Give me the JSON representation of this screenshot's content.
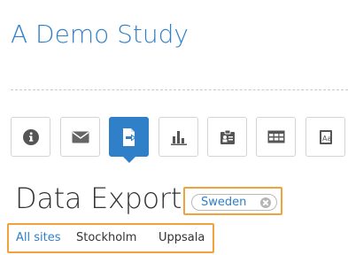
{
  "study": {
    "title": "A Demo Study"
  },
  "toolbar": {
    "buttons": [
      {
        "icon": "info-icon",
        "label": ""
      },
      {
        "icon": "mail-icon",
        "label": ""
      },
      {
        "icon": "export-icon",
        "label": "",
        "active": true
      },
      {
        "icon": "bar-chart-icon",
        "label": ""
      },
      {
        "icon": "id-card-icon",
        "label": ""
      },
      {
        "icon": "table-icon",
        "label": ""
      },
      {
        "icon": "font-icon",
        "label": ""
      }
    ]
  },
  "page": {
    "heading": "Data Export"
  },
  "site_chip": {
    "label": "Sweden"
  },
  "site_links": [
    {
      "label": "All sites",
      "current": true
    },
    {
      "label": "Stockholm",
      "current": false
    },
    {
      "label": "Uppsala",
      "current": false
    }
  ],
  "colors": {
    "accent": "#2f7fc9",
    "highlight": "#f0a33c"
  }
}
